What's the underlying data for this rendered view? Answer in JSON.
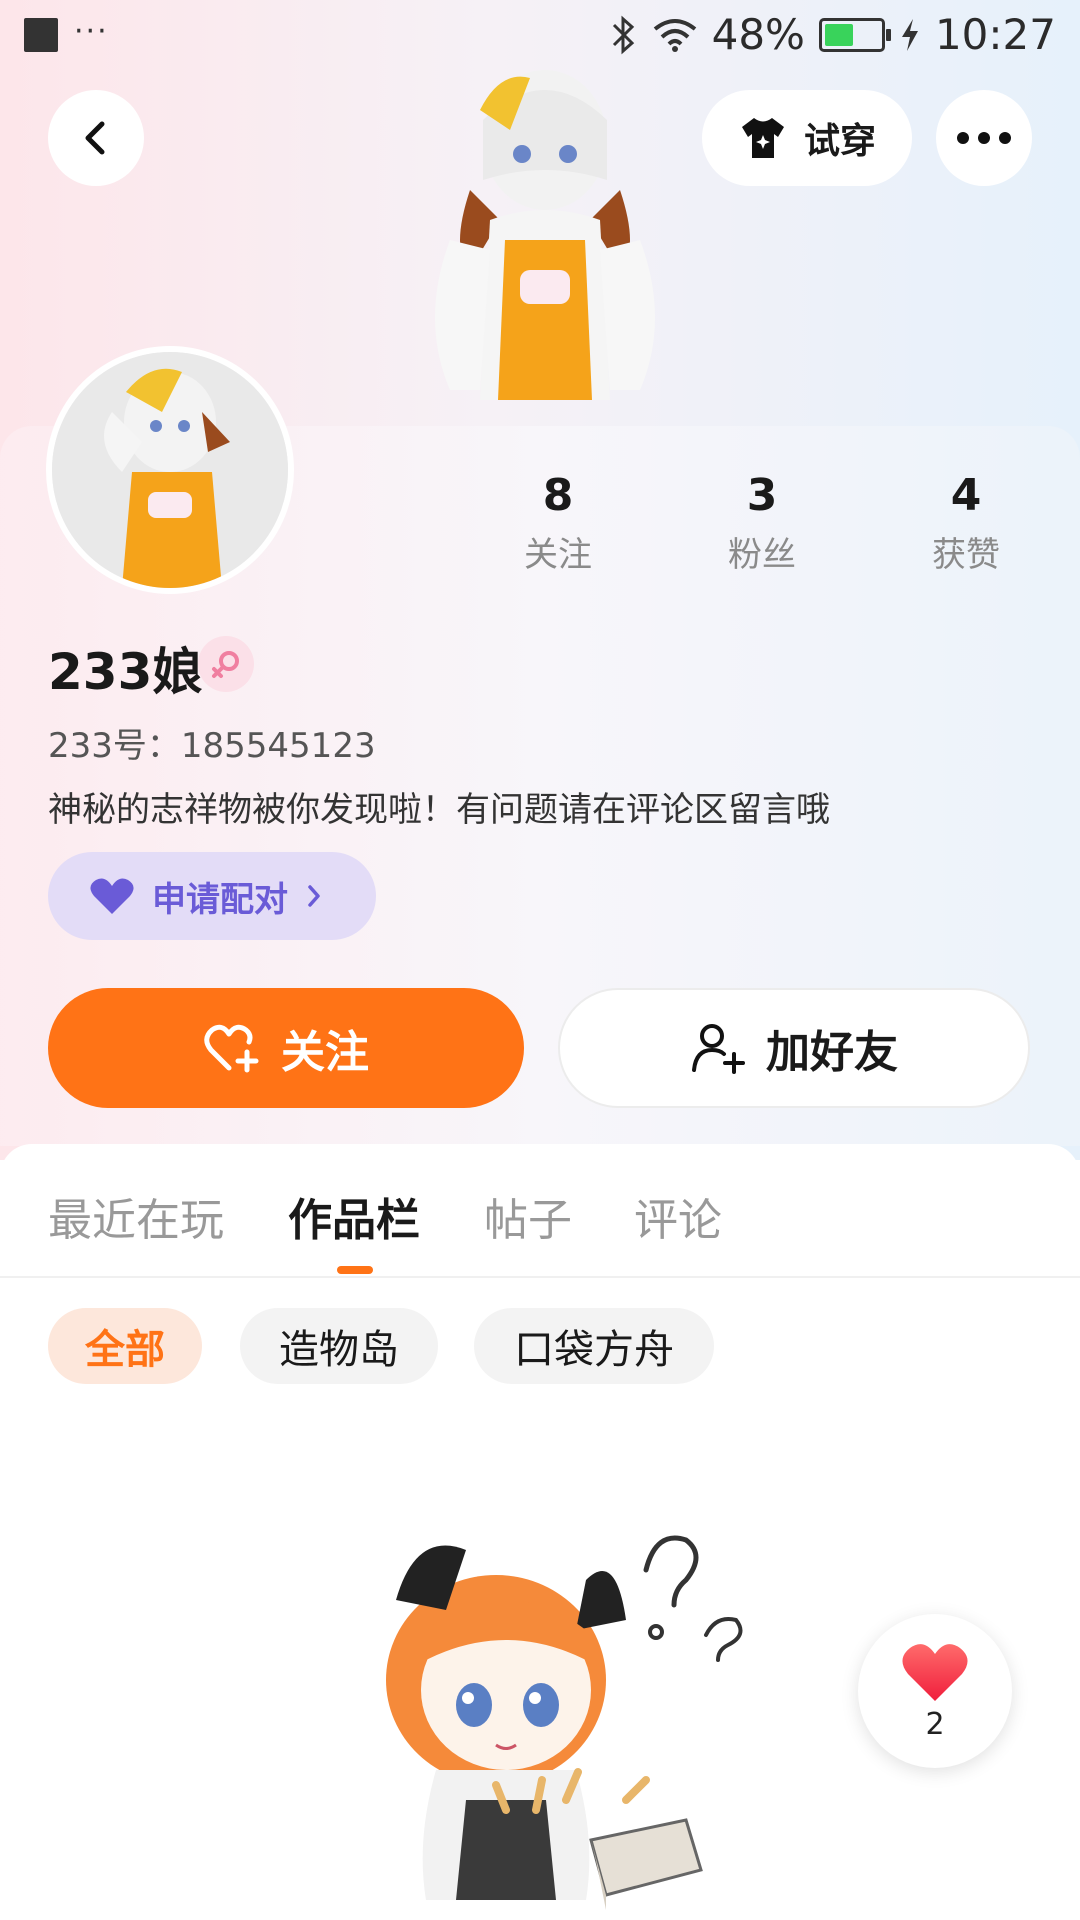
{
  "status_bar": {
    "menu_dots": "···",
    "battery": "48%",
    "time": "10:27"
  },
  "header": {
    "tryon_label": "试穿"
  },
  "profile": {
    "name": "233娘",
    "uid": "233号：185545123",
    "bio": "神秘的志祥物被你发现啦！有问题请在评论区留言哦",
    "pair_label": "申请配对"
  },
  "stats": [
    {
      "value": "8",
      "label": "关注"
    },
    {
      "value": "3",
      "label": "粉丝"
    },
    {
      "value": "4",
      "label": "获赞"
    }
  ],
  "actions": {
    "follow": "关注",
    "add_friend": "加好友"
  },
  "tabs": [
    {
      "label": "最近在玩"
    },
    {
      "label": "作品栏"
    },
    {
      "label": "帖子"
    },
    {
      "label": "评论"
    }
  ],
  "filters": [
    {
      "label": "全部"
    },
    {
      "label": "造物岛"
    },
    {
      "label": "口袋方舟"
    }
  ],
  "like_fab": {
    "count": "2"
  },
  "colors": {
    "accent": "#ff7316",
    "pair": "#6a5bd7",
    "battery": "#39d35b"
  }
}
